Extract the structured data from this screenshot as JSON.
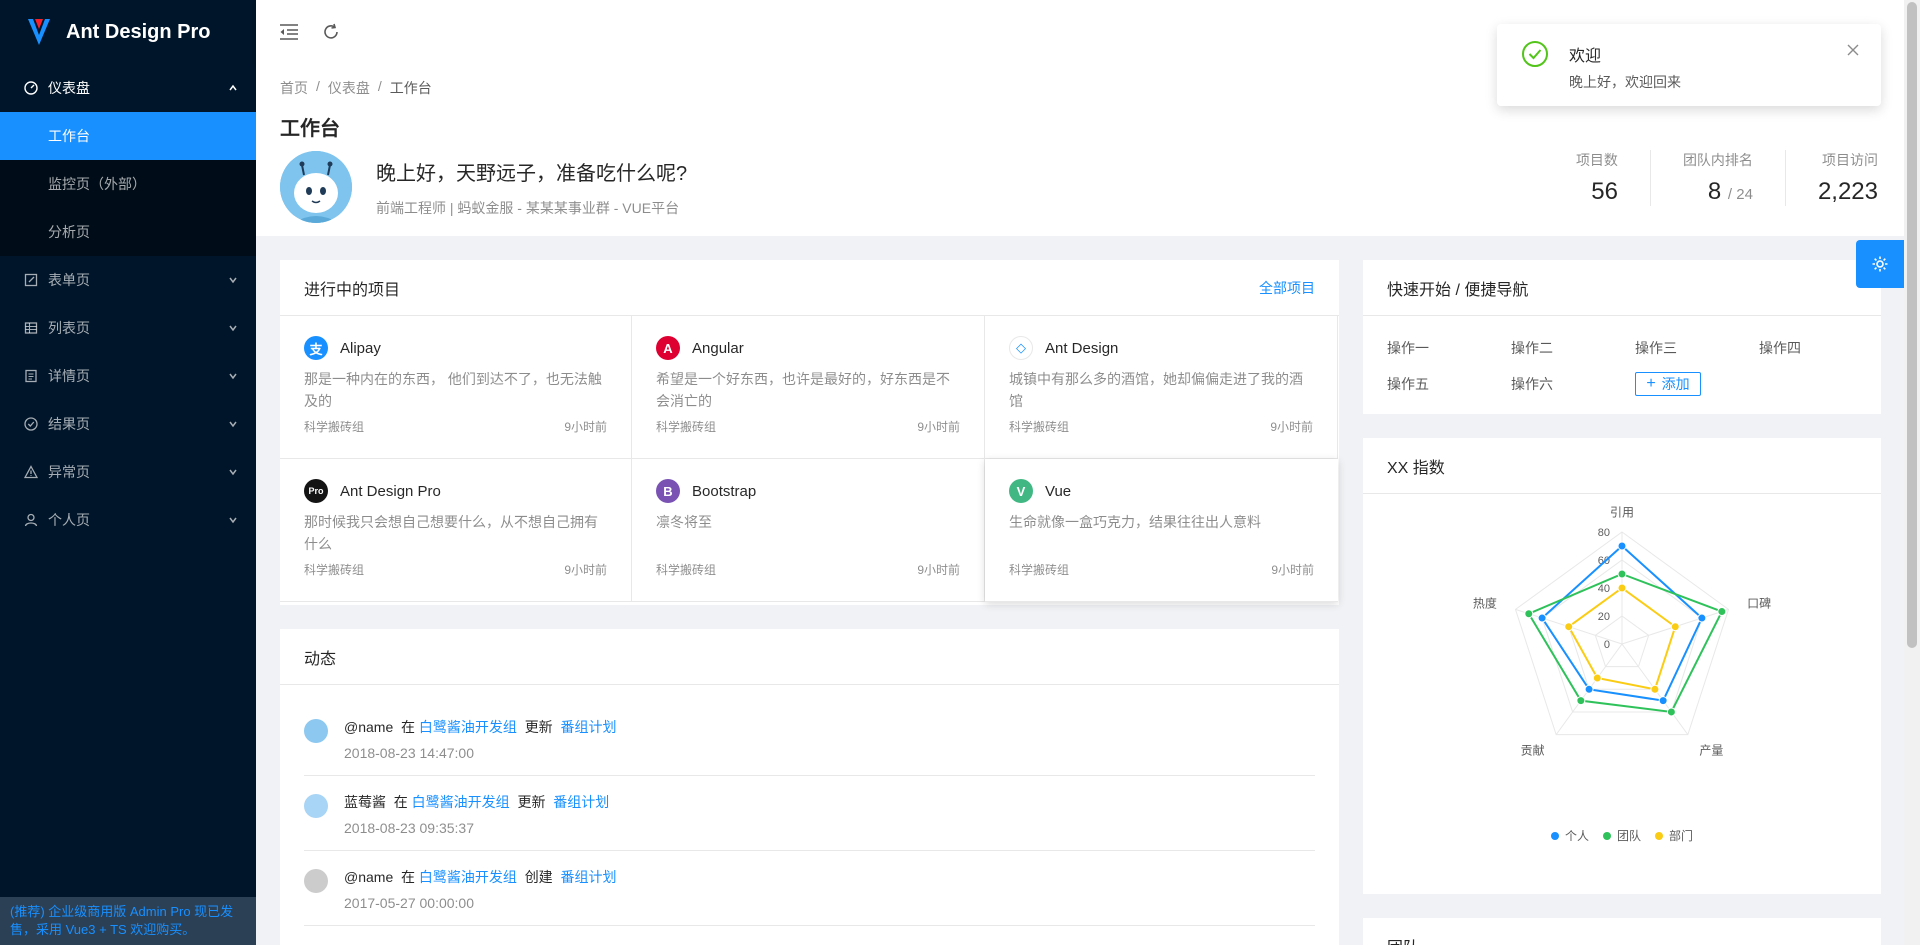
{
  "app": {
    "title": "Ant Design Pro"
  },
  "sidebar": {
    "items": [
      {
        "label": "仪表盘",
        "icon": "dashboard-icon"
      },
      {
        "label": "表单页",
        "icon": "form-icon"
      },
      {
        "label": "列表页",
        "icon": "table-icon"
      },
      {
        "label": "详情页",
        "icon": "profile-icon"
      },
      {
        "label": "结果页",
        "icon": "check-circle-icon"
      },
      {
        "label": "异常页",
        "icon": "warning-icon"
      },
      {
        "label": "个人页",
        "icon": "user-icon"
      }
    ],
    "sub_items": [
      {
        "label": "工作台"
      },
      {
        "label": "监控页（外部）"
      },
      {
        "label": "分析页"
      }
    ],
    "footer": "(推荐) 企业级商用版 Admin Pro 现已发售，采用 Vue3 + TS 欢迎购买。"
  },
  "breadcrumb": [
    "首页",
    "/",
    "仪表盘",
    "/",
    "工作台"
  ],
  "page_title": "工作台",
  "welcome": {
    "title": "晚上好，天野远子，准备吃什么呢?",
    "desc": "前端工程师 | 蚂蚁金服 - 某某某事业群 - VUE平台"
  },
  "stats": [
    {
      "label": "项目数",
      "value": "56",
      "suffix": ""
    },
    {
      "label": "团队内排名",
      "value": "8",
      "suffix": "/ 24"
    },
    {
      "label": "项目访问",
      "value": "2,223",
      "suffix": ""
    }
  ],
  "projects_card": {
    "title": "进行中的项目",
    "extra": "全部项目",
    "items": [
      {
        "title": "Alipay",
        "desc": "那是一种内在的东西， 他们到达不了，也无法触及的",
        "group": "科学搬砖组",
        "time": "9小时前",
        "color": "#1890ff",
        "logo": "支"
      },
      {
        "title": "Angular",
        "desc": "希望是一个好东西，也许是最好的，好东西是不会消亡的",
        "group": "科学搬砖组",
        "time": "9小时前",
        "color": "#dd0031",
        "logo": "A"
      },
      {
        "title": "Ant Design",
        "desc": "城镇中有那么多的酒馆，她却偏偏走进了我的酒馆",
        "group": "科学搬砖组",
        "time": "9小时前",
        "color": "#ffffff",
        "logo": "◇"
      },
      {
        "title": "Ant Design Pro",
        "desc": "那时候我只会想自己想要什么，从不想自己拥有什么",
        "group": "科学搬砖组",
        "time": "9小时前",
        "color": "#141414",
        "logo": "Pro"
      },
      {
        "title": "Bootstrap",
        "desc": "凛冬将至",
        "group": "科学搬砖组",
        "time": "9小时前",
        "color": "#7952b3",
        "logo": "B"
      },
      {
        "title": "Vue",
        "desc": "生命就像一盒巧克力，结果往往出人意料",
        "group": "科学搬砖组",
        "time": "9小时前",
        "color": "#41b883",
        "logo": "V"
      }
    ]
  },
  "activity_card": {
    "title": "动态",
    "items": [
      {
        "user": "@name",
        "in": "在",
        "group": "白鹭酱油开发组",
        "action": "更新",
        "project": "番组计划",
        "time": "2018-08-23 14:47:00",
        "avatar_color": "#8cc8f0"
      },
      {
        "user": "蓝莓酱",
        "in": "在",
        "group": "白鹭酱油开发组",
        "action": "更新",
        "project": "番组计划",
        "time": "2018-08-23 09:35:37",
        "avatar_color": "#a8d4f5"
      },
      {
        "user": "@name",
        "in": "在",
        "group": "白鹭酱油开发组",
        "action": "创建",
        "project": "番组计划",
        "time": "2017-05-27 00:00:00",
        "avatar_color": "#cccccc"
      }
    ]
  },
  "quick_card": {
    "title": "快速开始 / 便捷导航",
    "links": [
      "操作一",
      "操作二",
      "操作三",
      "操作四",
      "操作五",
      "操作六"
    ],
    "add_label": "添加"
  },
  "radar_card": {
    "title": "XX 指数"
  },
  "next_card": {
    "title": "团队"
  },
  "notification": {
    "title": "欢迎",
    "desc": "晚上好，欢迎回来"
  },
  "chart_data": {
    "type": "radar",
    "title": "",
    "axes": [
      "引用",
      "口碑",
      "产量",
      "贡献",
      "热度"
    ],
    "ticks": [
      "0",
      "20",
      "40",
      "60",
      "80"
    ],
    "range": [
      0,
      80
    ],
    "grid": true,
    "legend_position": "bottom",
    "series": [
      {
        "name": "个人",
        "color": "#1890ff",
        "values": [
          70,
          60,
          50,
          40,
          60
        ]
      },
      {
        "name": "团队",
        "color": "#2fc25b",
        "values": [
          50,
          75,
          60,
          50,
          70
        ]
      },
      {
        "name": "部门",
        "color": "#facc14",
        "values": [
          40,
          40,
          40,
          30,
          40
        ]
      }
    ]
  },
  "colors": {
    "primary": "#1890ff",
    "sider": "#001529",
    "success": "#52c41a"
  }
}
